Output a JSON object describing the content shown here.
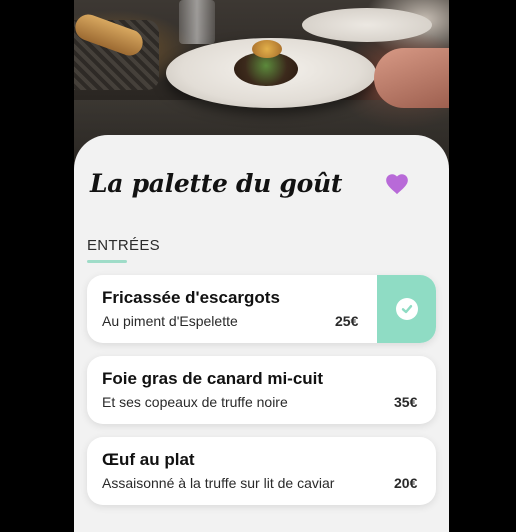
{
  "restaurant": {
    "title": "La palette du goût",
    "favorite_icon": "heart-icon",
    "favorite_color": "#b86ad8"
  },
  "section": {
    "label": "ENTRÉES",
    "underline_color": "#9fdcc8"
  },
  "dishes": [
    {
      "name": "Fricassée d'escargots",
      "description": "Au piment d'Espelette",
      "price": "25€",
      "selected": true
    },
    {
      "name": "Foie gras de canard mi-cuit",
      "description": "Et ses copeaux de truffe noire",
      "price": "35€",
      "selected": false
    },
    {
      "name": "Œuf au plat",
      "description": "Assaisonné à la truffe sur lit de caviar",
      "price": "20€",
      "selected": false
    }
  ],
  "selected_indicator": {
    "icon": "checkmark-icon",
    "color": "#8fdcc4"
  }
}
